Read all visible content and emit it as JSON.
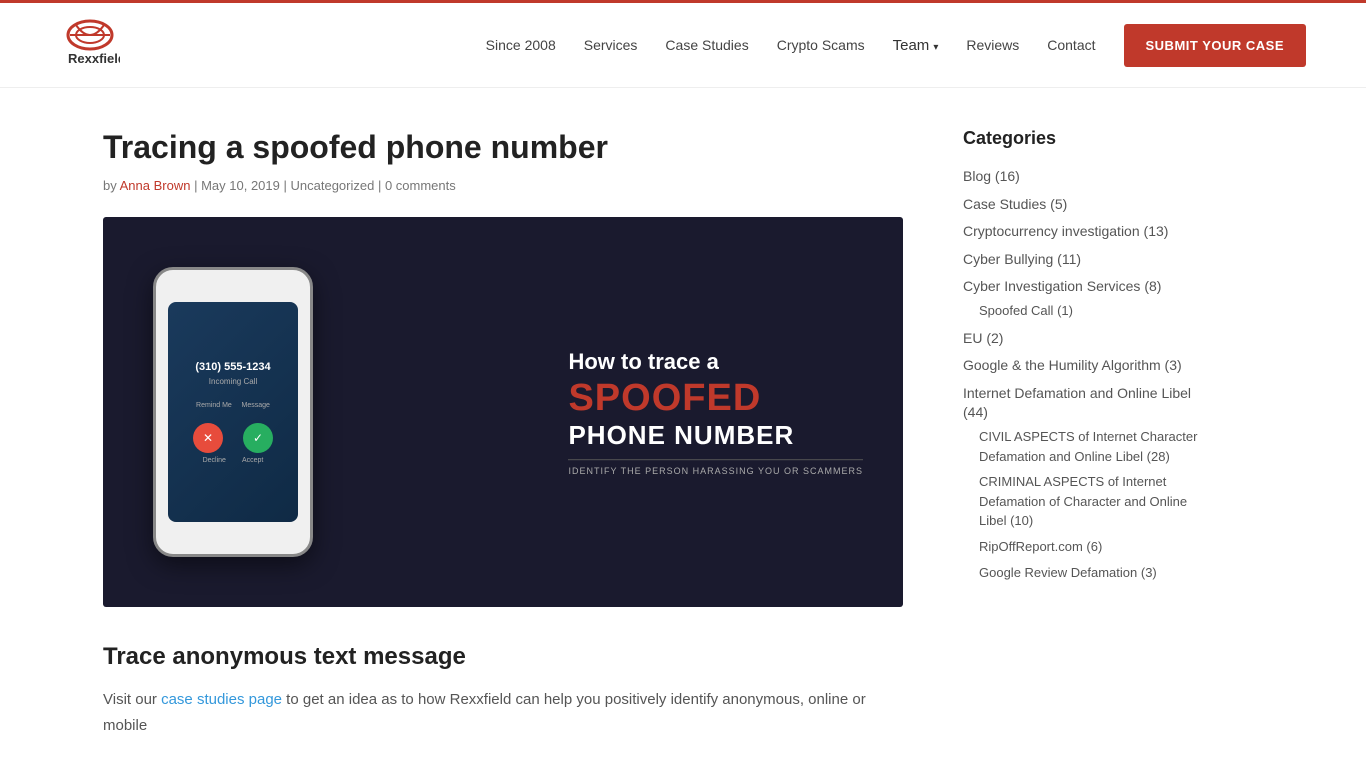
{
  "header": {
    "logo_text": "Rexxfield.",
    "nav": {
      "since": "Since 2008",
      "services": "Services",
      "case_studies": "Case Studies",
      "crypto_scams": "Crypto Scams",
      "team": "Team",
      "reviews": "Reviews",
      "contact": "Contact",
      "submit_label": "SUBMIT YOUR CASE"
    }
  },
  "post": {
    "title": "Tracing a spoofed phone number",
    "meta": {
      "by": "by",
      "author": "Anna Brown",
      "date": "May 10, 2019",
      "category": "Uncategorized",
      "comments": "0 comments"
    },
    "image": {
      "line1": "How to trace a",
      "line2": "SPOOFED",
      "line3": "PHONE NUMBER",
      "subtitle": "IDENTIFY THE PERSON HARASSING YOU OR SCAMMERS",
      "phone_number": "(310) 555-1234",
      "incoming": "Incoming Call"
    },
    "section1_title": "Trace anonymous text message",
    "body_text": "Visit our ",
    "body_link": "case studies page",
    "body_rest": " to get an idea as to how Rexxfield can help you positively identify anonymous, online or mobile"
  },
  "sidebar": {
    "title": "Categories",
    "categories": [
      {
        "label": "Blog",
        "count": "(16)",
        "indent": false
      },
      {
        "label": "Case Studies",
        "count": "(5)",
        "indent": false
      },
      {
        "label": "Cryptocurrency investigation",
        "count": "(13)",
        "indent": false
      },
      {
        "label": "Cyber Bullying",
        "count": "(11)",
        "indent": false
      },
      {
        "label": "Cyber Investigation Services",
        "count": "(8)",
        "indent": false
      },
      {
        "label": "Spoofed Call",
        "count": "(1)",
        "indent": true
      },
      {
        "label": "EU",
        "count": "(2)",
        "indent": false
      },
      {
        "label": "Google & the Humility Algorithm",
        "count": "(3)",
        "indent": false
      },
      {
        "label": "Internet Defamation and Online Libel",
        "count": "(44)",
        "indent": false
      },
      {
        "label": "CIVIL ASPECTS of Internet Character Defamation and Online Libel",
        "count": "(28)",
        "indent": true
      },
      {
        "label": "CRIMINAL ASPECTS of Internet Defamation of Character and Online Libel",
        "count": "(10)",
        "indent": true
      },
      {
        "label": "RipOffReport.com",
        "count": "(6)",
        "indent": true
      },
      {
        "label": "Google Review Defamation",
        "count": "(3)",
        "indent": true
      }
    ]
  }
}
